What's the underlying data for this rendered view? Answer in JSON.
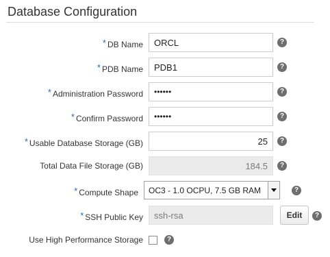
{
  "section": {
    "title": "Database Configuration"
  },
  "fields": [
    {
      "label": "DB Name",
      "value": "ORCL",
      "required": "*"
    },
    {
      "label": "PDB Name",
      "value": "PDB1",
      "required": "*"
    },
    {
      "label": "Administration Password",
      "value": "••••••",
      "required": "*"
    },
    {
      "label": "Confirm Password",
      "value": "••••••",
      "required": "*"
    },
    {
      "label": "Usable Database Storage (GB)",
      "value": "25",
      "required": "*"
    },
    {
      "label": "Total Data File Storage (GB)",
      "value": "184.5",
      "required": ""
    },
    {
      "label": "Compute Shape",
      "value": "OC3 - 1.0 OCPU, 7.5 GB RAM",
      "required": "*"
    },
    {
      "label": "SSH Public Key",
      "value": "ssh-rsa",
      "required": "*",
      "button": "Edit"
    },
    {
      "label": "Use High Performance Storage",
      "checked": false,
      "required": ""
    }
  ],
  "help_glyph": "?",
  "icons": {
    "help": "help-icon",
    "dropdown": "chevron-down-icon"
  }
}
